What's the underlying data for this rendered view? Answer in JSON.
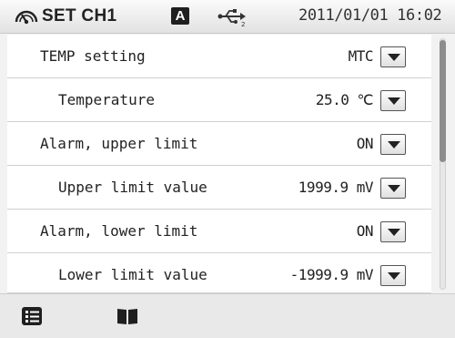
{
  "header": {
    "icon": "gauge-icon",
    "title": "SET CH1",
    "mode_badge": "A",
    "usb_icon": "usb-icon",
    "datetime": "2011/01/01 16:02"
  },
  "rows": [
    {
      "label": "TEMP setting",
      "value": "MTC"
    },
    {
      "label": "Temperature",
      "value": "25.0 ℃"
    },
    {
      "label": "Alarm, upper limit",
      "value": "ON"
    },
    {
      "label": "Upper limit value",
      "value": "1999.9 mV"
    },
    {
      "label": "Alarm, lower limit",
      "value": "ON"
    },
    {
      "label": "Lower limit value",
      "value": "-1999.9 mV"
    }
  ],
  "footer": {
    "menu_icon": "list-menu-icon",
    "manual_icon": "book-icon"
  },
  "colors": {
    "header_bg": "#e8e8e8",
    "list_bg": "#ffffff",
    "scroll_thumb": "#8d8d8d"
  }
}
